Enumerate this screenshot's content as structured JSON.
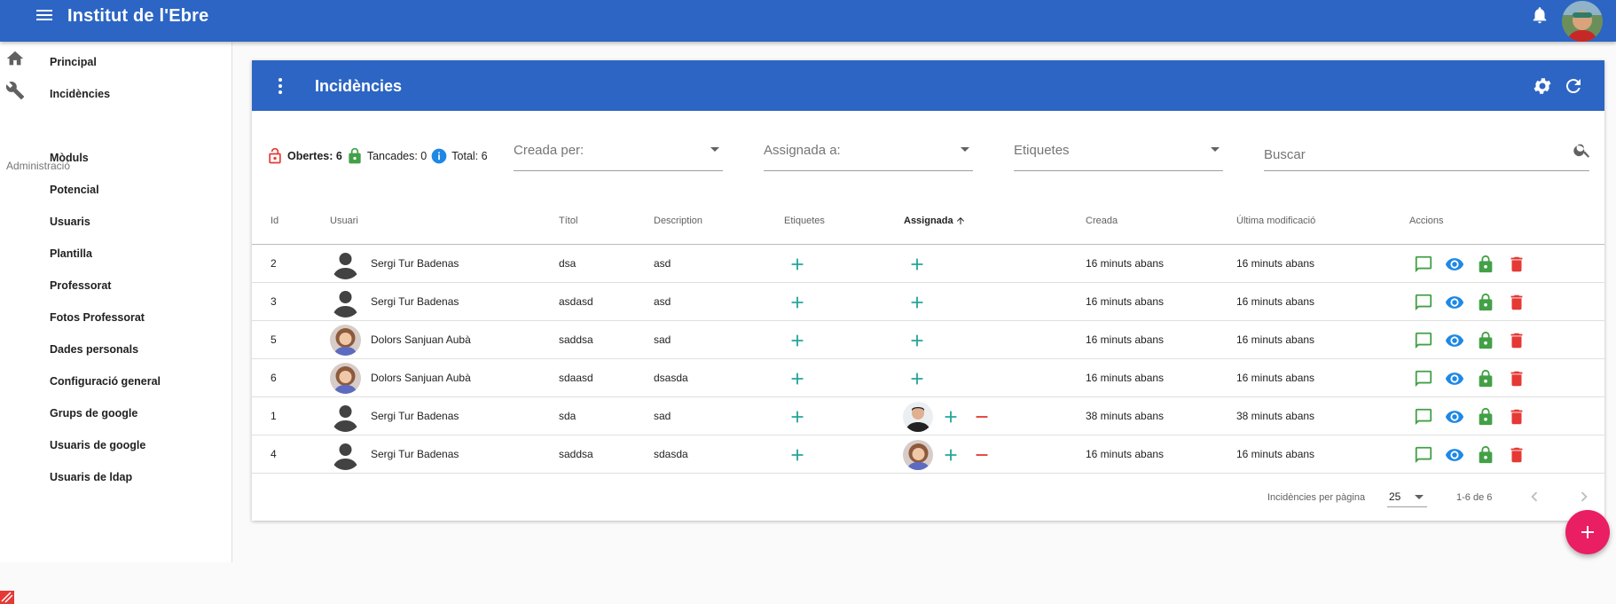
{
  "appbar": {
    "title": "Institut de l'Ebre"
  },
  "sidebar": {
    "top_items": [
      {
        "label": "Principal",
        "icon": "home-icon"
      },
      {
        "label": "Incidències",
        "icon": "wrench-icon"
      }
    ],
    "section_label": "Administració",
    "admin_items": [
      {
        "label": "Mòduls"
      },
      {
        "label": "Potencial"
      },
      {
        "label": "Usuaris"
      },
      {
        "label": "Plantilla"
      },
      {
        "label": "Professorat"
      },
      {
        "label": "Fotos Professorat"
      },
      {
        "label": "Dades personals"
      },
      {
        "label": "Configuració general"
      },
      {
        "label": "Grups de google"
      },
      {
        "label": "Usuaris de google"
      },
      {
        "label": "Usuaris de ldap"
      }
    ]
  },
  "card": {
    "title": "Incidències",
    "summary": {
      "open_label": "Obertes: 6",
      "closed_label": "Tancades: 0",
      "total_label": "Total: 6"
    },
    "filters": {
      "created_by": "Creada per:",
      "assigned_to": "Assignada a:",
      "tags": "Etiquetes",
      "search_placeholder": "Buscar"
    }
  },
  "table": {
    "headers": {
      "id": "Id",
      "user": "Usuari",
      "title": "Títol",
      "description": "Description",
      "tags": "Etiquetes",
      "assigned": "Assignada",
      "created": "Creada",
      "modified": "Última modificació",
      "actions": "Accions"
    },
    "rows": [
      {
        "id": "2",
        "user": "Sergi Tur Badenas",
        "user_avatar": "silhouette",
        "title": "dsa",
        "description": "asd",
        "assignee": null,
        "created": "16 minuts abans",
        "modified": "16 minuts abans"
      },
      {
        "id": "3",
        "user": "Sergi Tur Badenas",
        "user_avatar": "silhouette",
        "title": "asdasd",
        "description": "asd",
        "assignee": null,
        "created": "16 minuts abans",
        "modified": "16 minuts abans"
      },
      {
        "id": "5",
        "user": "Dolors Sanjuan Aubà",
        "user_avatar": "woman",
        "title": "saddsa",
        "description": "sad",
        "assignee": null,
        "created": "16 minuts abans",
        "modified": "16 minuts abans"
      },
      {
        "id": "6",
        "user": "Dolors Sanjuan Aubà",
        "user_avatar": "woman",
        "title": "sdaasd",
        "description": "dsasda",
        "assignee": null,
        "created": "16 minuts abans",
        "modified": "16 minuts abans"
      },
      {
        "id": "1",
        "user": "Sergi Tur Badenas",
        "user_avatar": "silhouette",
        "title": "sda",
        "description": "sad",
        "assignee": "man",
        "created": "38 minuts abans",
        "modified": "38 minuts abans"
      },
      {
        "id": "4",
        "user": "Sergi Tur Badenas",
        "user_avatar": "silhouette",
        "title": "saddsa",
        "description": "sdasda",
        "assignee": "woman",
        "created": "16 minuts abans",
        "modified": "16 minuts abans"
      }
    ]
  },
  "pagination": {
    "per_page_label": "Incidències per pàgina",
    "per_page_value": "25",
    "range": "1-6 de 6"
  },
  "colors": {
    "primary": "#2d65c4",
    "teal": "#26a69a",
    "green": "#43a047",
    "blue": "#1e88e5",
    "red": "#e53935",
    "fab": "#e91e63"
  }
}
